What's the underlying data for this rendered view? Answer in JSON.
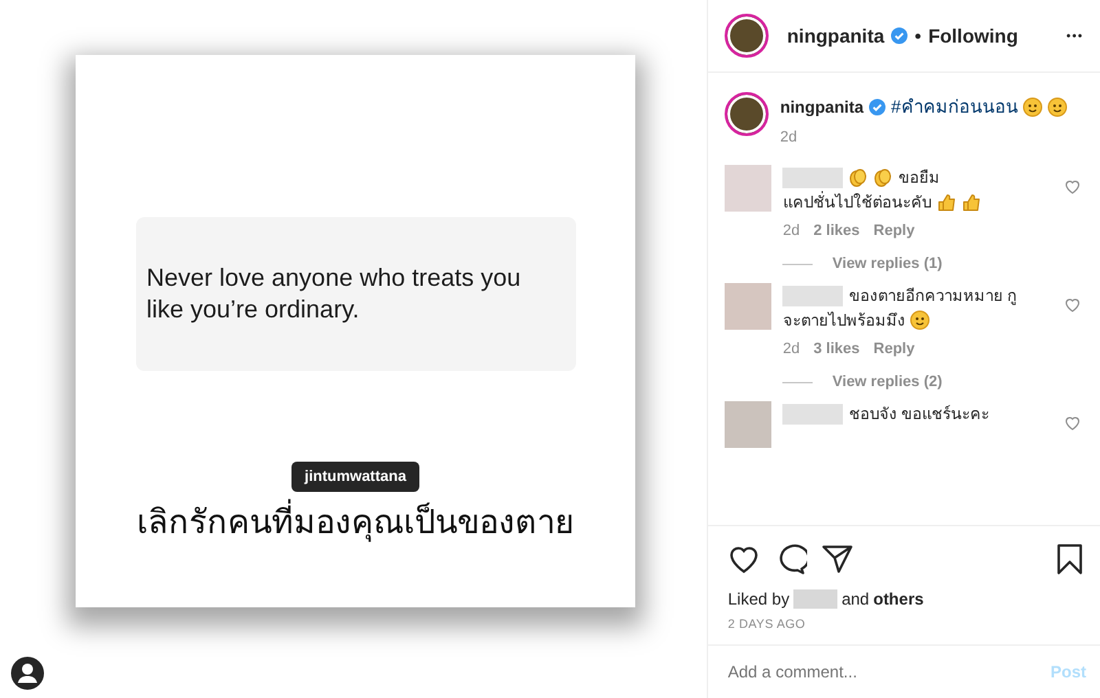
{
  "post_image": {
    "quote": "Never love anyone who treats you like you’re ordinary.",
    "caption": "เลิกรักคนที่มองคุณเป็นของตาย",
    "tag": "jintumwattana"
  },
  "header": {
    "username": "ningpanita",
    "verified": true,
    "separator": "•",
    "follow_label": "Following",
    "more": "•••"
  },
  "caption": {
    "username": "ningpanita",
    "verified": true,
    "text": "#คำคมก่อนนอน",
    "emojis": [
      {
        "kind": "face"
      },
      {
        "kind": "face"
      }
    ],
    "time": "2d"
  },
  "comments": [
    {
      "text_lines": [
        "ขอยืม",
        "แคปชั่นไปใช้ต่อนะคับ"
      ],
      "lead_emojis": [
        {
          "kind": "clap"
        },
        {
          "kind": "clap"
        }
      ],
      "tail_emojis": [
        {
          "kind": "thumb"
        },
        {
          "kind": "thumb"
        }
      ],
      "color": "#e2d6d6",
      "time": "2d",
      "likes": "2 likes",
      "reply": "Reply",
      "view_replies": "View replies (1)"
    },
    {
      "text_lines": [
        "ของตายอีกความหมาย กู",
        "จะตายไปพร้อมมึง"
      ],
      "tail_emojis": [
        {
          "kind": "face"
        }
      ],
      "color": "#d6c6c0",
      "time": "2d",
      "likes": "3 likes",
      "reply": "Reply",
      "view_replies": "View replies (2)"
    },
    {
      "text_lines": [
        "ชอบจัง ขอแชร์นะคะ"
      ],
      "color": "#cbc2bc"
    }
  ],
  "likes": {
    "prefix": "Liked by",
    "suffix": "and",
    "others": "others"
  },
  "date": "2 DAYS AGO",
  "comment_box": {
    "placeholder": "Add a comment...",
    "post": "Post"
  }
}
